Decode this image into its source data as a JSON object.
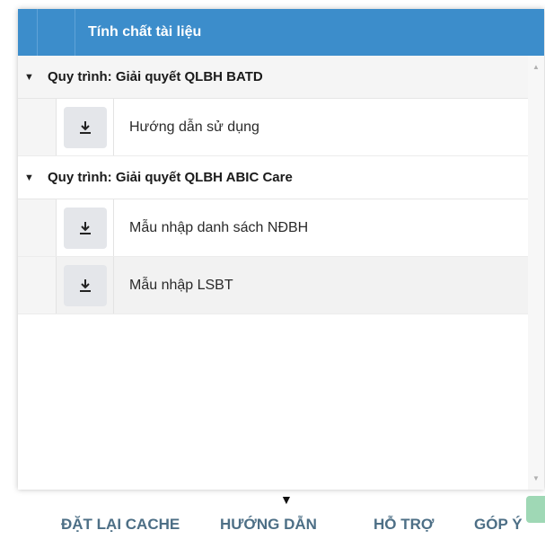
{
  "table": {
    "header": "Tính chất tài liệu",
    "groups": [
      {
        "title": "Quy trình: Giải quyết QLBH BATD",
        "rows": [
          {
            "label": "Hướng dẫn sử dụng"
          }
        ]
      },
      {
        "title": "Quy trình: Giải quyết QLBH ABIC Care",
        "rows": [
          {
            "label": "Mẫu nhập danh sách NĐBH"
          },
          {
            "label": "Mẫu nhập LSBT"
          }
        ]
      }
    ]
  },
  "icons": {
    "group_toggle": "caret-down-icon",
    "row_action": "download-icon"
  },
  "colors": {
    "header_bg": "#3c8dcb",
    "footer_text": "#4d6f86"
  },
  "footer": {
    "reset_cache": "ĐẶT LẠI CACHE",
    "guide": "HƯỚNG DẪN",
    "support": "HỖ TRỢ",
    "feedback": "GÓP Ý"
  }
}
